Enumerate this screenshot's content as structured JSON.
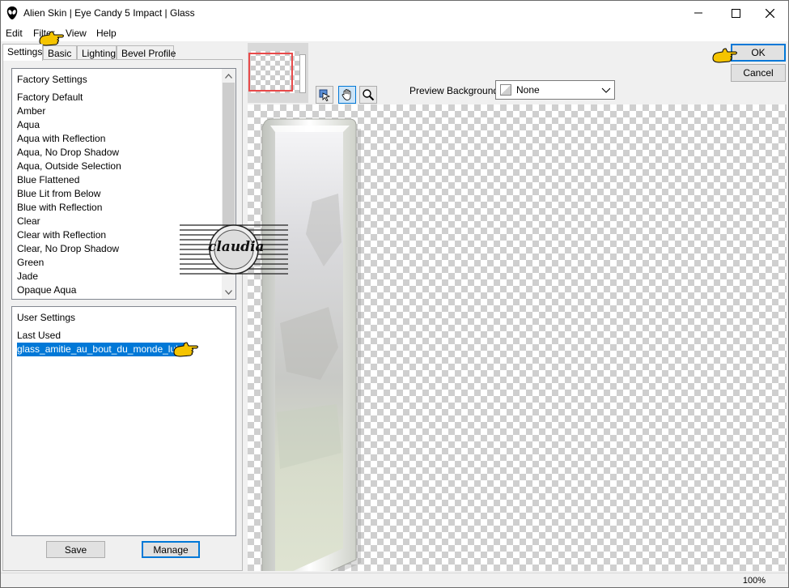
{
  "window": {
    "title": "Alien Skin | Eye Candy 5 Impact | Glass"
  },
  "menu": [
    "Edit",
    "Filter",
    "View",
    "Help"
  ],
  "tabs": [
    "Settings",
    "Basic",
    "Lighting",
    "Bevel Profile"
  ],
  "factory": {
    "header": "Factory Settings",
    "items": [
      "Factory Default",
      "Amber",
      "Aqua",
      "Aqua with Reflection",
      "Aqua, No Drop Shadow",
      "Aqua, Outside Selection",
      "Blue Flattened",
      "Blue Lit from Below",
      "Blue with Reflection",
      "Clear",
      "Clear with Reflection",
      "Clear, No Drop Shadow",
      "Green",
      "Jade",
      "Opaque Aqua"
    ]
  },
  "user": {
    "header": "User Settings",
    "items": [
      "Last Used",
      "glass_amitie_au_bout_du_monde_lulu"
    ]
  },
  "buttons": {
    "save": "Save",
    "manage": "Manage",
    "ok": "OK",
    "cancel": "Cancel"
  },
  "preview": {
    "label": "Preview Background:",
    "value": "None"
  },
  "status": {
    "zoom": "100%"
  },
  "watermark": {
    "text": "claudia"
  },
  "colors": {
    "selection": "#0078d7",
    "pointer": "#f5c400"
  },
  "icons": {
    "app": "alien-head-icon",
    "hand_tool": "hand-icon",
    "zoom_tool": "magnifier-icon",
    "move_tool": "pan-icon"
  }
}
